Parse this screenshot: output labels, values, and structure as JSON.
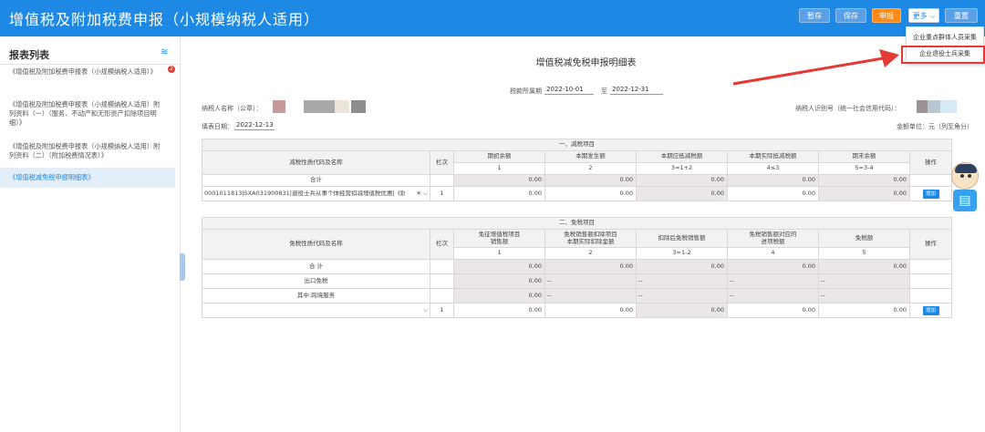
{
  "header": {
    "title": "增值税及附加税费申报（小规模纳税人适用）",
    "buttons": {
      "temp_save": "暂存",
      "save": "保存",
      "declare": "申报",
      "more": "更多",
      "reset": "重置"
    },
    "more_menu": [
      "企业重点群体人员采集",
      "企业退役士兵采集"
    ]
  },
  "sidebar": {
    "heading": "报表列表",
    "badge": "2",
    "items": [
      "《增值税及附加税费申报表（小规模纳税人适用）》",
      "《增值税及附加税费申报表（小规模纳税人适用）附列资料（一）（服务、不动产和无形资产扣除项目明细）》",
      "《增值税及附加税费申报表（小规模纳税人适用）附列资料（二）（附加税费情况表）》",
      "《增值税减免税申报明细表》"
    ]
  },
  "form": {
    "title": "增值税减免税申报明细表",
    "period_label": "税款所属期",
    "period_from": "2022-10-01",
    "period_to_label": "至",
    "period_to": "2022-12-31",
    "taxpayer_name_label": "纳税人名称（公章）：",
    "taxpayer_id_label": "纳税人识别号（统一社会信用代码）：",
    "fill_date_label": "填表日期：",
    "fill_date": "2022-12-13",
    "unit_label": "金额单位：元（列至角分）"
  },
  "table1": {
    "section_title": "一、减税项目",
    "col_name": "减税性质代码及名称",
    "col_row": "栏次",
    "col_op": "操作",
    "headers": [
      "期初余额",
      "本期发生额",
      "本期应抵减税额",
      "本期实际抵减税额",
      "期末余额"
    ],
    "formulas": [
      "1",
      "2",
      "3=1+2",
      "4≤3",
      "5=3-4"
    ],
    "total_label": "合计",
    "total_values": [
      "0.00",
      "0.00",
      "0.00",
      "0.00",
      "0.00"
    ],
    "row1": {
      "name": "0001011813|SXA031900831|退役士兵从事个体经营扣减增值税优惠|《财",
      "row_no": "1",
      "values": [
        "0.00",
        "0.00",
        "0.00",
        "0.00",
        "0.00"
      ],
      "add": "增加"
    }
  },
  "table2": {
    "section_title": "二、免税项目",
    "col_name": "免税性质代码及名称",
    "col_row": "栏次",
    "col_op": "操作",
    "headers": [
      "免征增值税项目\n销售额",
      "免税销售额扣除项目\n本期实际扣除金额",
      "扣除后免税销售额",
      "免税销售额对应的\n进项税额",
      "免税额"
    ],
    "formulas": [
      "1",
      "2",
      "3=1-2",
      "4",
      "5"
    ],
    "total_label": "合 计",
    "total_values": [
      "0.00",
      "0.00",
      "0.00",
      "0.00",
      "0.00"
    ],
    "export_label": "出口免税",
    "export_values": [
      "0.00",
      "--",
      "--",
      "--",
      "--"
    ],
    "cross_label": "其中:跨境服务",
    "cross_values": [
      "0.00",
      "--",
      "--",
      "--",
      "--"
    ],
    "row1": {
      "row_no": "1",
      "values": [
        "0.00",
        "0.00",
        "0.00",
        "0.00",
        "0.00"
      ],
      "add": "增加"
    }
  },
  "colors": {
    "brand": "#1e88e5",
    "declare": "#ff8c1a",
    "highlight": "#e53935"
  }
}
